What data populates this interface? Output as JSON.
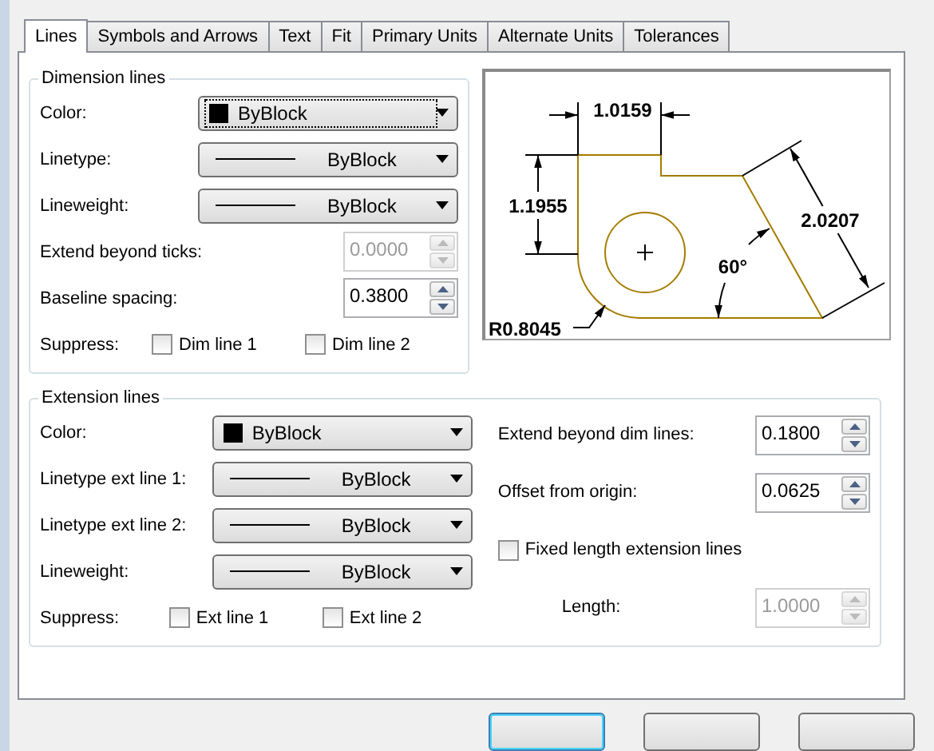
{
  "tabs": [
    {
      "label": "Lines",
      "selected": true
    },
    {
      "label": "Symbols and Arrows",
      "selected": false
    },
    {
      "label": "Text",
      "selected": false
    },
    {
      "label": "Fit",
      "selected": false
    },
    {
      "label": "Primary Units",
      "selected": false
    },
    {
      "label": "Alternate Units",
      "selected": false
    },
    {
      "label": "Tolerances",
      "selected": false
    }
  ],
  "dimension_lines": {
    "title": "Dimension lines",
    "rows": [
      {
        "kind": "color_dropdown",
        "label": "Color:",
        "value": "ByBlock",
        "focused": true
      },
      {
        "kind": "line_dropdown",
        "label": "Linetype:",
        "value": "ByBlock"
      },
      {
        "kind": "line_dropdown",
        "label": "Lineweight:",
        "value": "ByBlock"
      },
      {
        "kind": "spinner",
        "label": "Extend beyond ticks:",
        "value": "0.0000",
        "disabled": true
      },
      {
        "kind": "spinner",
        "label": "Baseline spacing:",
        "value": "0.3800",
        "disabled": false
      },
      {
        "kind": "checkboxes",
        "label": "Suppress:",
        "options": [
          {
            "label": "Dim line 1",
            "checked": false
          },
          {
            "label": "Dim line 2",
            "checked": false
          }
        ]
      }
    ]
  },
  "preview": {
    "labels": [
      "1.0159",
      "1.1955",
      "2.0207",
      "60°",
      "R0.8045"
    ]
  },
  "extension_lines": {
    "title": "Extension lines",
    "left_rows": [
      {
        "kind": "color_dropdown",
        "label": "Color:",
        "value": "ByBlock",
        "focused": false
      },
      {
        "kind": "line_dropdown",
        "label": "Linetype ext line 1:",
        "value": "ByBlock"
      },
      {
        "kind": "line_dropdown",
        "label": "Linetype ext line 2:",
        "value": "ByBlock"
      },
      {
        "kind": "line_dropdown",
        "label": "Lineweight:",
        "value": "ByBlock"
      },
      {
        "kind": "checkboxes",
        "label": "Suppress:",
        "options": [
          {
            "label": "Ext line 1",
            "checked": false
          },
          {
            "label": "Ext line 2",
            "checked": false
          }
        ]
      }
    ],
    "right_rows": [
      {
        "kind": "spinner",
        "label": "Extend beyond dim lines:",
        "value": "0.1800",
        "disabled": false
      },
      {
        "kind": "spinner",
        "label": "Offset from origin:",
        "value": "0.0625",
        "disabled": false
      },
      {
        "kind": "checkbox",
        "label": "Fixed length extension lines",
        "checked": false
      },
      {
        "kind": "indented_spinner",
        "label": "Length:",
        "value": "1.0000",
        "disabled": true
      }
    ]
  },
  "buttons": [
    {
      "kind": "default"
    },
    {
      "kind": "normal"
    },
    {
      "kind": "normal"
    }
  ]
}
